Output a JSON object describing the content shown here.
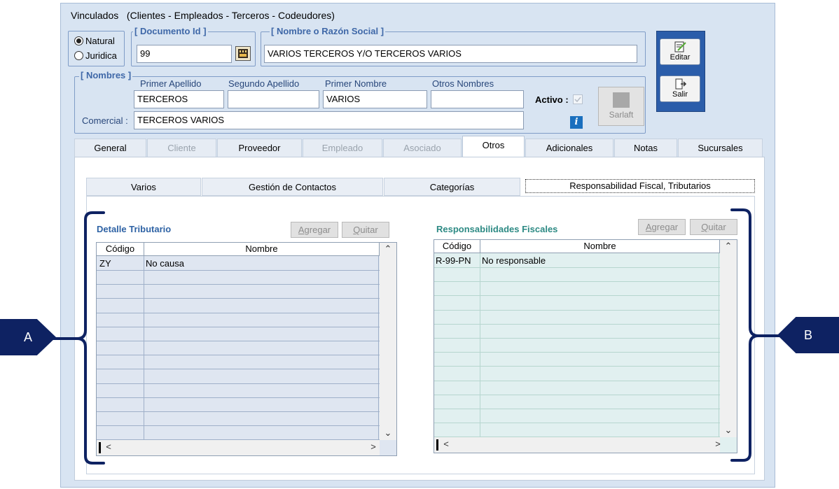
{
  "window": {
    "title": "Vinculados",
    "subtitle": "(Clientes - Empleados - Terceros - Codeudores)"
  },
  "person_type": {
    "natural": "Natural",
    "juridica": "Juridica",
    "selected": "Natural"
  },
  "documento": {
    "legend": "[ Documento Id ]",
    "value": "99"
  },
  "razon_social": {
    "legend": "[ Nombre o Razón Social ]",
    "value": "VARIOS TERCEROS Y/O TERCEROS VARIOS"
  },
  "nombres": {
    "legend": "[ Nombres ]",
    "primer_apellido_label": "Primer Apellido",
    "primer_apellido": "TERCEROS",
    "segundo_apellido_label": "Segundo Apellido",
    "segundo_apellido": "",
    "primer_nombre_label": "Primer Nombre",
    "primer_nombre": "VARIOS",
    "otros_nombres_label": "Otros Nombres",
    "otros_nombres": "",
    "comercial_label": "Comercial :",
    "comercial": "TERCEROS VARIOS",
    "activo_label": "Activo :",
    "sarlaft_label": "Sarlaft"
  },
  "side_buttons": {
    "editar": "Editar",
    "salir": "Salir"
  },
  "tabs": [
    {
      "label": "General",
      "state": "normal"
    },
    {
      "label": "Cliente",
      "state": "disabled"
    },
    {
      "label": "Proveedor",
      "state": "normal"
    },
    {
      "label": "Empleado",
      "state": "disabled"
    },
    {
      "label": "Asociado",
      "state": "disabled"
    },
    {
      "label": "Otros",
      "state": "active"
    },
    {
      "label": "Adicionales",
      "state": "normal"
    },
    {
      "label": "Notas",
      "state": "normal"
    },
    {
      "label": "Sucursales",
      "state": "normal"
    }
  ],
  "subtabs": [
    {
      "label": "Varios"
    },
    {
      "label": "Gestión de Contactos"
    },
    {
      "label": "Categorías"
    },
    {
      "label": "Responsabilidad Fiscal, Tributarios"
    }
  ],
  "detalle": {
    "title": "Detalle Tributario",
    "agregar": "Agregar",
    "quitar": "Quitar",
    "col_codigo": "Código",
    "col_nombre": "Nombre",
    "rows": [
      {
        "codigo": "ZY",
        "nombre": "No causa"
      }
    ]
  },
  "responsabilidades": {
    "title": "Responsabilidades Fiscales",
    "agregar": "Agregar",
    "quitar": "Quitar",
    "col_codigo": "Código",
    "col_nombre": "Nombre",
    "rows": [
      {
        "codigo": "R-99-PN",
        "nombre": "No responsable"
      }
    ]
  },
  "annotations": {
    "a": "A",
    "b": "B"
  },
  "colors": {
    "window_bg": "#d8e4f2",
    "legend_blue": "#3f68a8",
    "annotation_navy": "#0e2262",
    "grid_left_bg": "#dfe6f1",
    "grid_right_bg": "#e1f0f0"
  }
}
